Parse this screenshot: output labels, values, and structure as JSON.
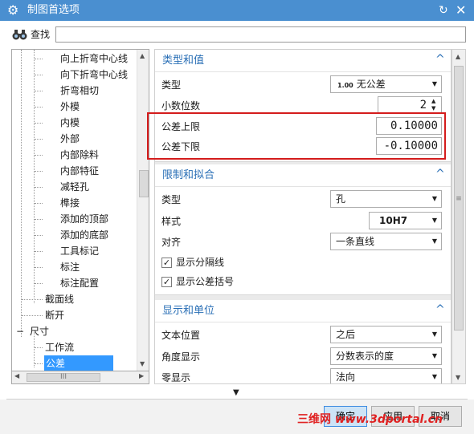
{
  "window": {
    "title": "制图首选项"
  },
  "find": {
    "label": "查找",
    "value": ""
  },
  "tree": {
    "items": [
      {
        "label": "向上折弯中心线",
        "level": 3
      },
      {
        "label": "向下折弯中心线",
        "level": 3
      },
      {
        "label": "折弯相切",
        "level": 3
      },
      {
        "label": "外模",
        "level": 3
      },
      {
        "label": "内模",
        "level": 3
      },
      {
        "label": "外部",
        "level": 3
      },
      {
        "label": "内部除料",
        "level": 3
      },
      {
        "label": "内部特征",
        "level": 3
      },
      {
        "label": "减轻孔",
        "level": 3
      },
      {
        "label": "榫接",
        "level": 3
      },
      {
        "label": "添加的顶部",
        "level": 3
      },
      {
        "label": "添加的底部",
        "level": 3
      },
      {
        "label": "工具标记",
        "level": 3
      },
      {
        "label": "标注",
        "level": 3
      },
      {
        "label": "标注配置",
        "level": 3
      },
      {
        "label": "截面线",
        "level": 2
      },
      {
        "label": "断开",
        "level": 2
      },
      {
        "label": "尺寸",
        "level": 1,
        "expander": "−"
      },
      {
        "label": "工作流",
        "level": 2
      },
      {
        "label": "公差",
        "level": 2,
        "selected": true
      }
    ],
    "hscroll_grip": "III"
  },
  "sections": {
    "type_value": {
      "title": "类型和值",
      "caret": "^",
      "type_label": "类型",
      "type_value": "无公差",
      "type_icon_text": "1.00",
      "decimals_label": "小数位数",
      "decimals_value": "2",
      "upper_label": "公差上限",
      "upper_value": "0.10000",
      "lower_label": "公差下限",
      "lower_value": "-0.10000"
    },
    "limits_fits": {
      "title": "限制和拟合",
      "caret": "^",
      "type_label": "类型",
      "type_value": "孔",
      "style_label": "样式",
      "style_value": "10H7",
      "align_label": "对齐",
      "align_value": "一条直线",
      "show_separator_label": "显示分隔线",
      "show_separator_checked": true,
      "show_brackets_label": "显示公差括号",
      "show_brackets_checked": true
    },
    "display_units": {
      "title": "显示和单位",
      "caret": "^",
      "text_pos_label": "文本位置",
      "text_pos_value": "之后",
      "angle_label": "角度显示",
      "angle_value": "分数表示的度",
      "zero_label": "零显示",
      "zero_value": "法向"
    }
  },
  "panel_scroll_grip": "≡",
  "buttons": {
    "ok": "确定",
    "apply": "应用",
    "cancel": "取消"
  },
  "watermark": {
    "cn": "三维网",
    "en": "www.3dportal.cn"
  },
  "colors": {
    "titlebar": "#4a8fd0",
    "section_title": "#2a6fb6",
    "highlight": "#d41c1c",
    "selection": "#3399ff"
  }
}
